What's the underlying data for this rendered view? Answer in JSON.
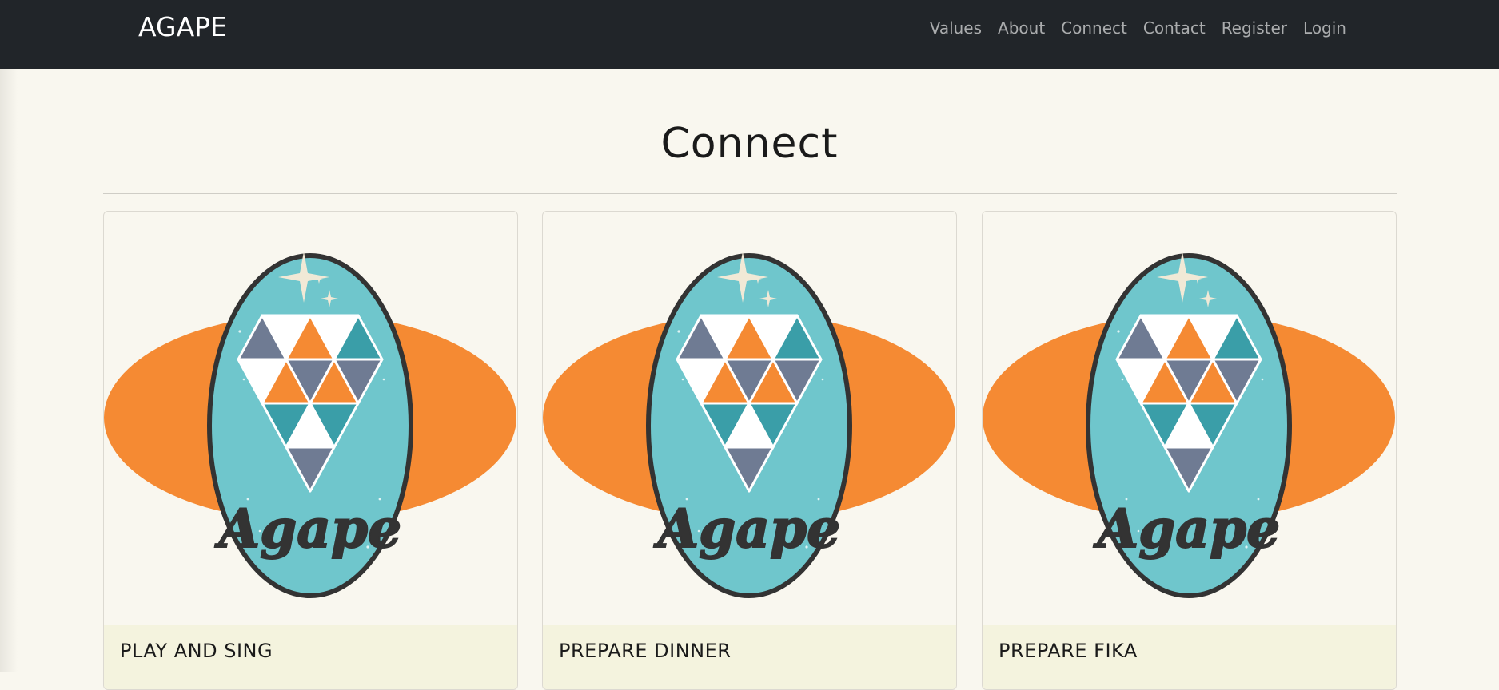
{
  "navbar": {
    "brand": "AGAPE",
    "links": [
      "Values",
      "About",
      "Connect",
      "Contact",
      "Register",
      "Login"
    ]
  },
  "page": {
    "title": "Connect"
  },
  "cards": [
    {
      "title": "PLAY AND SING",
      "logo_text": "Agape"
    },
    {
      "title": "PREPARE DINNER",
      "logo_text": "Agape"
    },
    {
      "title": "PREPARE FIKA",
      "logo_text": "Agape"
    }
  ],
  "colors": {
    "navbar_bg": "#212529",
    "page_bg": "#f9f7ef",
    "card_footer_bg": "#f4f3de",
    "logo_orange": "#f58a33",
    "logo_teal": "#6fc6cc",
    "logo_slate": "#6f7b93",
    "logo_dark": "#333333"
  }
}
